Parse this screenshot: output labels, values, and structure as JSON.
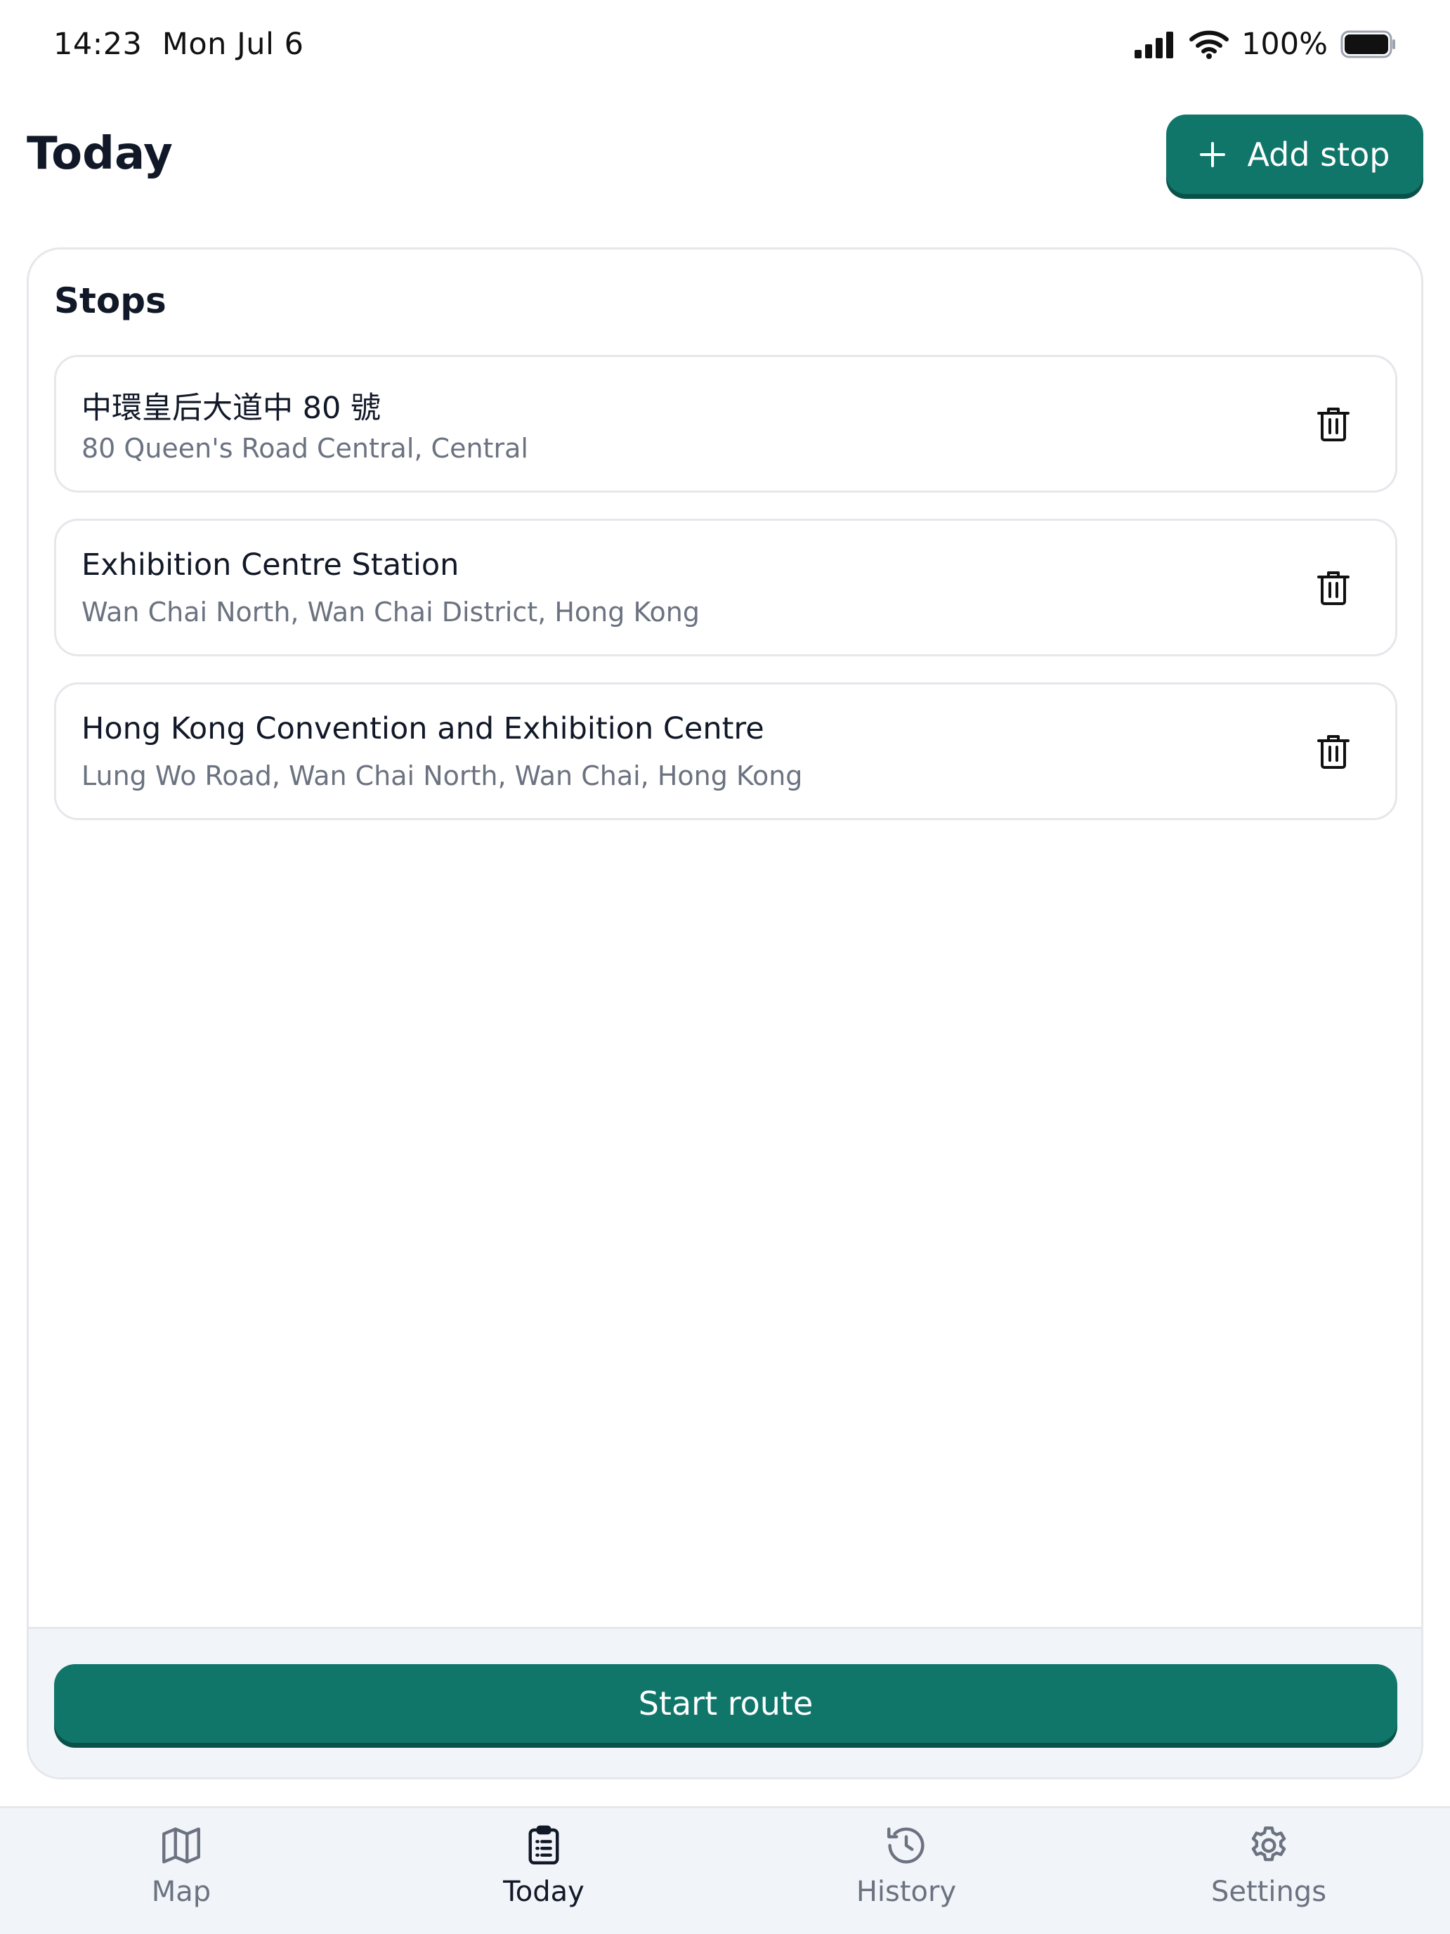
{
  "status_bar": {
    "time": "14:23",
    "date": "Mon Jul 6",
    "battery_percent": "100%",
    "icons": [
      "cellular-signal-icon",
      "wifi-icon",
      "battery-icon"
    ]
  },
  "header": {
    "title": "Today",
    "add_stop_label": "Add stop"
  },
  "stops": {
    "title": "Stops",
    "items": [
      {
        "name": "中環皇后大道中 80 號",
        "address": "80 Queen's Road Central, Central"
      },
      {
        "name": "Exhibition Centre Station",
        "address": "Wan Chai North, Wan Chai District, Hong Kong"
      },
      {
        "name": "Hong Kong Convention and Exhibition Centre",
        "address": "Lung Wo Road, Wan Chai North, Wan Chai, Hong Kong"
      }
    ],
    "start_route_label": "Start route"
  },
  "tabs": [
    {
      "label": "Map",
      "icon": "map-icon",
      "active": false
    },
    {
      "label": "Today",
      "icon": "clipboard-list-icon",
      "active": true
    },
    {
      "label": "History",
      "icon": "history-icon",
      "active": false
    },
    {
      "label": "Settings",
      "icon": "gear-icon",
      "active": false
    }
  ],
  "colors": {
    "accent": "#10766a",
    "text_primary": "#111827",
    "text_secondary": "#6b7280",
    "border": "#e5e7eb",
    "footer_bg": "#f1f4f8"
  }
}
